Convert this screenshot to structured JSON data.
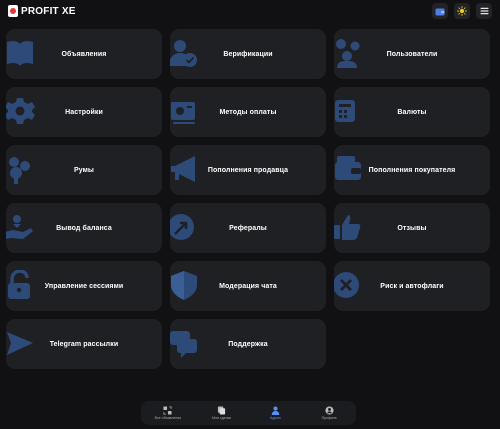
{
  "header": {
    "brand": "PROFIT XE",
    "actions": [
      {
        "icon": "wallet-icon"
      },
      {
        "icon": "sun-icon"
      },
      {
        "icon": "menu-icon"
      }
    ]
  },
  "colors": {
    "background": "#111113",
    "card": "#1f2024",
    "icon": "#2e4a78",
    "accent": "#5b8ff9",
    "logo_red": "#e23a3a"
  },
  "cards": [
    {
      "label": "Объявления",
      "icon": "book-icon"
    },
    {
      "label": "Верификации",
      "icon": "user-check-icon"
    },
    {
      "label": "Пользователи",
      "icon": "users-icon"
    },
    {
      "label": "Настройки",
      "icon": "gear-icon"
    },
    {
      "label": "Методы оплаты",
      "icon": "payment-icon"
    },
    {
      "label": "Валюты",
      "icon": "currency-icon"
    },
    {
      "label": "Румы",
      "icon": "door-icon"
    },
    {
      "label": "Пополнения продавца",
      "icon": "megaphone-icon"
    },
    {
      "label": "Пополнения покупателя",
      "icon": "wallet-icon"
    },
    {
      "label": "Вывод баланса",
      "icon": "hand-coin-icon"
    },
    {
      "label": "Рефералы",
      "icon": "referral-icon"
    },
    {
      "label": "Отзывы",
      "icon": "thumbs-up-icon"
    },
    {
      "label": "Управление сессиями",
      "icon": "lock-icon"
    },
    {
      "label": "Модерация чата",
      "icon": "shield-icon"
    },
    {
      "label": "Риск и автофлаги",
      "icon": "close-circle-icon"
    },
    {
      "label": "Telegram рассылки",
      "icon": "send-icon"
    },
    {
      "label": "Поддержка",
      "icon": "chat-icon"
    }
  ],
  "bottom_nav": [
    {
      "label": "Все объявления",
      "icon": "exchange-icon",
      "active": false
    },
    {
      "label": "Мои сделки",
      "icon": "copy-icon",
      "active": false
    },
    {
      "label": "Админ",
      "icon": "admin-person-icon",
      "active": true
    },
    {
      "label": "Профиль",
      "icon": "profile-icon",
      "active": false
    }
  ]
}
